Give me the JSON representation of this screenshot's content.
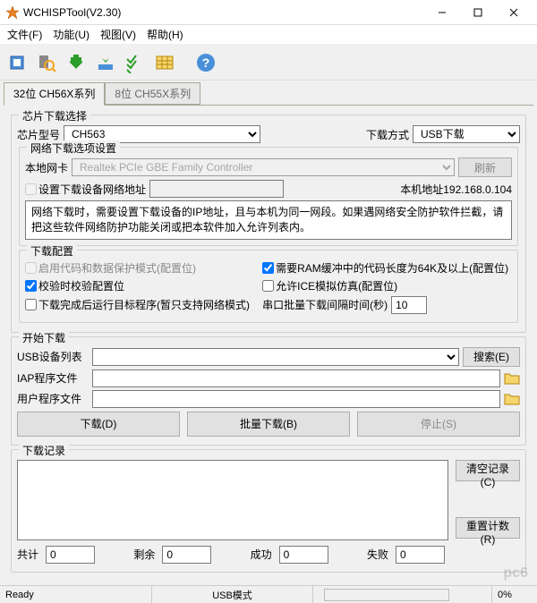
{
  "window": {
    "title": "WCHISPTool(V2.30)"
  },
  "menu": {
    "file": "文件(F)",
    "func": "功能(U)",
    "view": "视图(V)",
    "help": "帮助(H)"
  },
  "tabs": {
    "tab1": "32位 CH56X系列",
    "tab2": "8位 CH55X系列"
  },
  "chipSelect": {
    "legend": "芯片下载选择",
    "modelLabel": "芯片型号",
    "modelValue": "CH563",
    "methodLabel": "下载方式",
    "methodValue": "USB下载"
  },
  "netOpt": {
    "legend": "网络下载选项设置",
    "nicLabel": "本地网卡",
    "nicValue": "Realtek PCIe GBE Family Controller",
    "refresh": "刷新",
    "setAddrChk": "设置下载设备网络地址",
    "hostLabel": "本机地址",
    "hostValue": "192.168.0.104",
    "note": "网络下载时，需要设置下载设备的IP地址，且与本机为同一网段。如果遇网络安全防护软件拦截，请把这些软件网络防护功能关闭或把本软件加入允许列表内。"
  },
  "dlCfg": {
    "legend": "下载配置",
    "chk1": "启用代码和数据保护模式(配置位)",
    "chk2": "校验时校验配置位",
    "chk3": "下载完成后运行目标程序(暂只支持网络模式)",
    "chk4": "需要RAM缓冲中的代码长度为64K及以上(配置位)",
    "chk5": "允许ICE模拟仿真(配置位)",
    "intervalLabel": "串口批量下载间隔时间(秒)",
    "intervalValue": "10"
  },
  "startDl": {
    "legend": "开始下载",
    "usbListLabel": "USB设备列表",
    "search": "搜索(E)",
    "iapLabel": "IAP程序文件",
    "userLabel": "用户程序文件",
    "download": "下载(D)",
    "batch": "批量下载(B)",
    "stop": "停止(S)"
  },
  "log": {
    "legend": "下载记录",
    "clear": "清空记录(C)",
    "resetCount": "重置计数(R)",
    "totalLabel": "共计",
    "totalValue": "0",
    "remainLabel": "剩余",
    "remainValue": "0",
    "successLabel": "成功",
    "successValue": "0",
    "failLabel": "失败",
    "failValue": "0"
  },
  "status": {
    "ready": "Ready",
    "mode": "USB模式",
    "percent": "0%"
  }
}
